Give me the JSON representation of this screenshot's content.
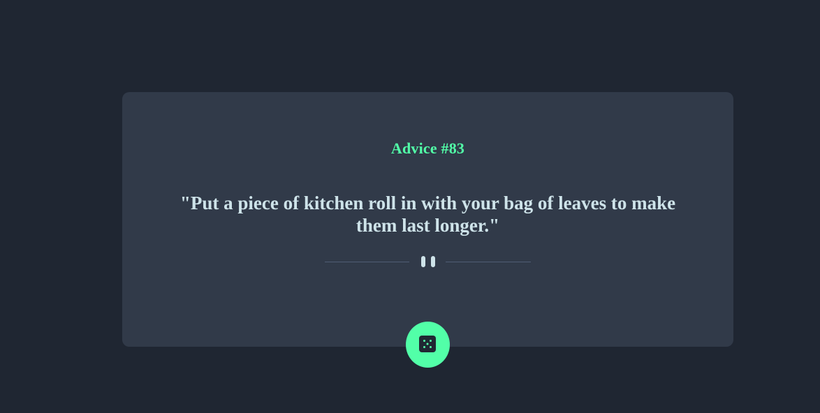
{
  "advice": {
    "title": "Advice #83",
    "quote": "\"Put a piece of kitchen roll in with your bag of leaves to make them last longer.\""
  },
  "divider": {
    "icon": "pause-icon"
  },
  "dice_button": {
    "icon": "dice-icon"
  },
  "colors": {
    "background": "#1f2632",
    "card": "#313a49",
    "accent": "#52ffa8",
    "text": "#cee3e9",
    "divider_line": "#4f5d74"
  }
}
